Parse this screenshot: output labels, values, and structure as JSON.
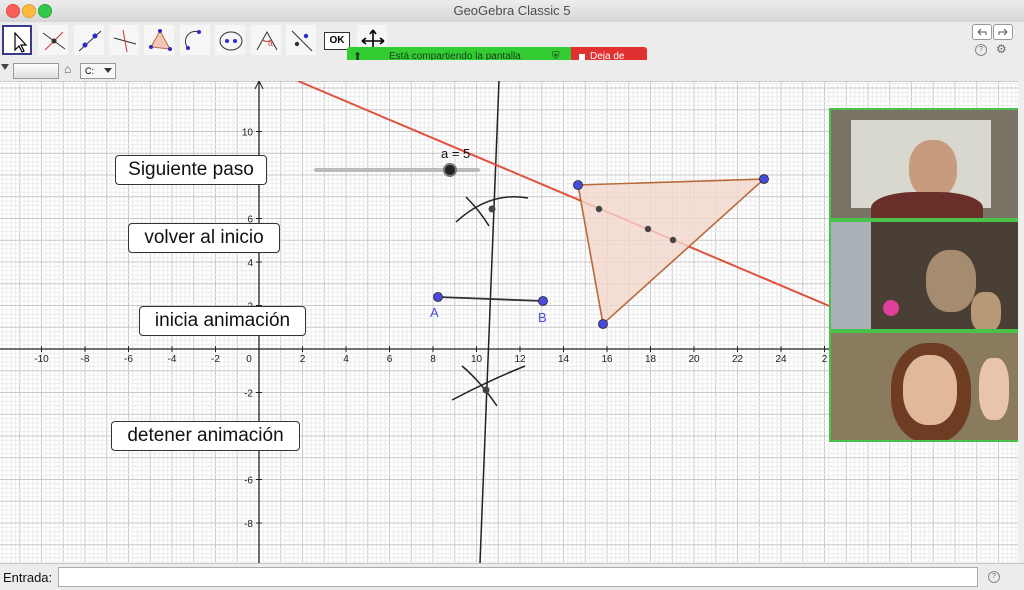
{
  "window": {
    "title": "GeoGebra Classic 5"
  },
  "sharing": {
    "text": "Está compartiendo la pantalla",
    "stop_label": "Deja de"
  },
  "toolbar": {
    "ok_label": "OK",
    "subbar_label": "C:"
  },
  "buttons": {
    "next": "Siguiente paso",
    "reset": "volver al inicio",
    "start": "inicia animación",
    "stop": "detener animación"
  },
  "slider": {
    "label": "a = 5",
    "value": 5
  },
  "points": {
    "a": "A",
    "b": "B"
  },
  "axes": {
    "x_ticks": [
      "-10",
      "-8",
      "-6",
      "-4",
      "-2",
      "0",
      "2",
      "4",
      "6",
      "8",
      "10",
      "12",
      "14",
      "16",
      "18",
      "20",
      "22",
      "24",
      "2"
    ],
    "y_ticks": [
      "10",
      "6",
      "4",
      "2",
      "-2",
      "-4",
      "-6",
      "-8"
    ]
  },
  "input": {
    "label": "Entrada:",
    "value": ""
  },
  "colors": {
    "line": "#e0523f",
    "triangle_edge": "#b86a3a",
    "triangle_fill": "#f3d7cc",
    "point": "#4a4adf",
    "share_green": "#33cc33",
    "share_red": "#e03030"
  }
}
